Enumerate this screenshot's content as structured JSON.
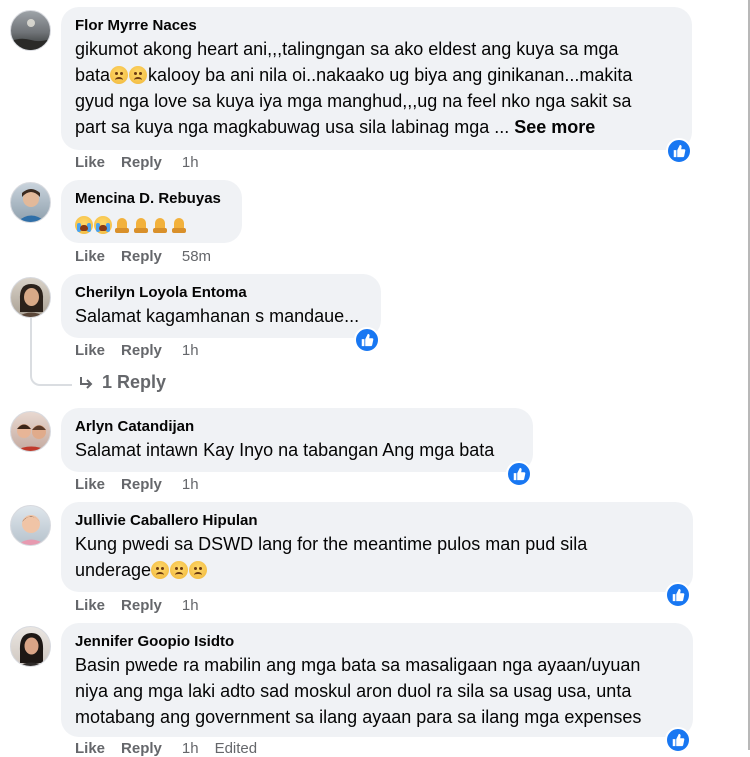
{
  "comments": [
    {
      "author": "Flor Myrre Naces",
      "text_line1": "gikumot akong heart ani,,,talingngan sa ako eldest ang kuya sa mga",
      "text_line2_pre": "bata",
      "text_line2_post": "kalooy ba ani nila oi..nakaako ug biya ang ginikanan...makita",
      "text_line3": "gyud nga love sa kuya iya mga manghud,,,ug na feel nko nga sakit sa",
      "text_line4": "part sa kuya nga magkabuwag usa sila labinag mga ... ",
      "see_more": "See more",
      "like": "Like",
      "reply": "Reply",
      "time": "1h"
    },
    {
      "author": "Mencina D. Rebuyas",
      "like": "Like",
      "reply": "Reply",
      "time": "58m"
    },
    {
      "author": "Cherilyn Loyola Entoma",
      "text": "Salamat kagamhanan s mandaue...",
      "like": "Like",
      "reply": "Reply",
      "time": "1h",
      "replies_label": "1 Reply"
    },
    {
      "author": "Arlyn Catandijan",
      "text": "Salamat intawn Kay Inyo na tabangan Ang mga bata",
      "like": "Like",
      "reply": "Reply",
      "time": "1h"
    },
    {
      "author": "Jullivie Caballero Hipulan",
      "text_line1": "Kung pwedi sa DSWD lang for the meantime pulos man pud sila",
      "text_line2": "underage",
      "like": "Like",
      "reply": "Reply",
      "time": "1h"
    },
    {
      "author": "Jennifer Goopio Isidto",
      "text_line1": "Basin pwede ra mabilin ang mga bata sa masaligaan nga ayaan/uyuan",
      "text_line2": "niya ang mga laki adto sad moskul aron duol ra sila sa usag usa, unta",
      "text_line3": "motabang ang government sa ilang ayaan para sa ilang mga expenses",
      "like": "Like",
      "reply": "Reply",
      "time": "1h",
      "edited": "Edited"
    }
  ],
  "colors": {
    "bubble": "#f0f2f5",
    "meta": "#65676b",
    "like_blue": "#1877f2"
  },
  "icons": [
    "like-reaction-icon",
    "reply-arrow-icon",
    "sad-face-emoji",
    "crying-face-emoji",
    "folded-hands-emoji"
  ]
}
